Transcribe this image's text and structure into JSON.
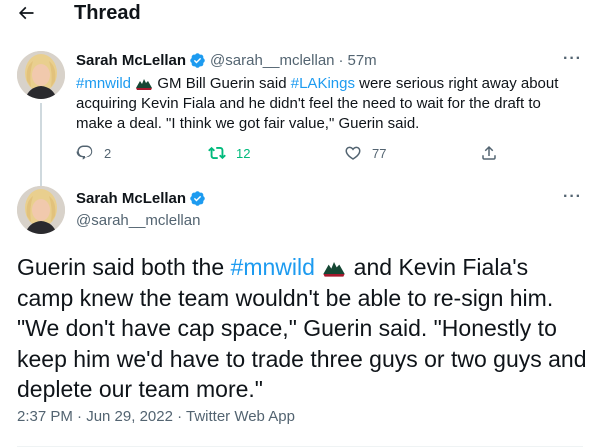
{
  "header": {
    "title": "Thread",
    "back_icon": "arrow-left-icon"
  },
  "colors": {
    "accent": "#1d9bf0",
    "retweet": "#00ba7c",
    "muted": "#536471",
    "text": "#0f1419"
  },
  "tweet1": {
    "author_name": "Sarah McLellan",
    "handle": "@sarah__mclellan",
    "separator": "·",
    "time": "57m",
    "hashtag1": "#mnwild",
    "text_a": " GM Bill Guerin said ",
    "hashtag2": "#LAKings",
    "text_b": " were serious right away about acquiring Kevin Fiala and he didn't feel the need to wait for the draft to make a deal. \"I think we got fair value,\" Guerin said.",
    "reply_count": "2",
    "retweet_count": "12",
    "like_count": "77",
    "more": "···"
  },
  "tweet2": {
    "author_name": "Sarah McLellan",
    "handle": "@sarah__mclellan",
    "text_a": "Guerin said both the ",
    "hashtag": "#mnwild",
    "text_b": " and Kevin Fiala's camp knew the team wouldn't be able to re-sign him. \"We don't have cap space,\" Guerin said. \"Honestly to keep him we'd have to trade three guys or two guys and deplete our team more.\"",
    "timestamp": "2:37 PM · Jun 29, 2022 · Twitter Web App",
    "more": "···"
  }
}
